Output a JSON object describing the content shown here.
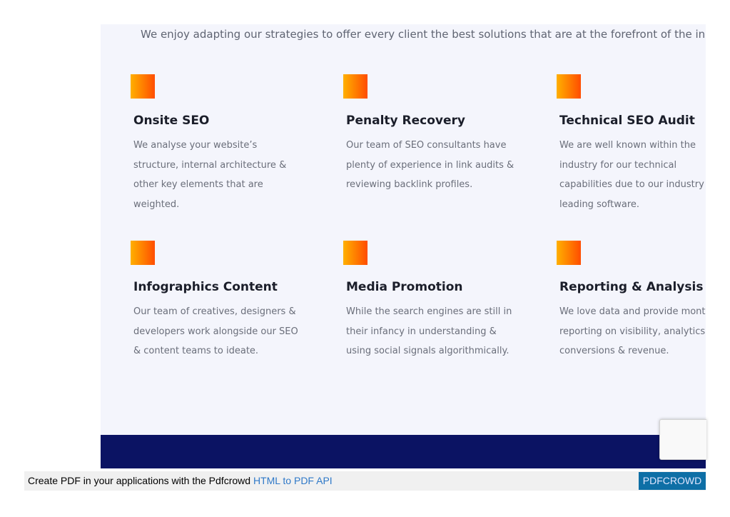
{
  "intro": {
    "text": "We enjoy adapting our strategies to offer every client the best solutions that are at the forefront of the indust"
  },
  "services": [
    {
      "title": "Onsite SEO",
      "lines": [
        "We analyse your website’s",
        "structure, internal architecture &",
        "other key elements that are",
        "weighted."
      ]
    },
    {
      "title": "Penalty Recovery",
      "lines": [
        "Our team of SEO consultants have",
        "plenty of experience in link audits &",
        "reviewing backlink profiles."
      ]
    },
    {
      "title": "Technical SEO Audit",
      "lines": [
        "We are well known within the",
        "industry for our technical",
        "capabilities due to our industry",
        "leading software."
      ]
    },
    {
      "title": "Infographics Content",
      "lines": [
        "Our team of creatives, designers &",
        "developers work alongside our SEO",
        "& content teams to ideate."
      ]
    },
    {
      "title": "Media Promotion",
      "lines": [
        "While the search engines are still in",
        "their infancy in understanding &",
        "using social signals algorithmically."
      ]
    },
    {
      "title": "Reporting & Analysis",
      "lines": [
        "We love data and provide mont",
        "reporting on visibility, analytics,",
        "conversions & revenue."
      ]
    }
  ],
  "pdf_bar": {
    "prefix": "Create PDF in your applications with the Pdfcrowd ",
    "link": "HTML to PDF API",
    "button": "PDFCROWD"
  },
  "colors": {
    "content_background": "#f4f5fc",
    "footer_band": "#0b1363",
    "icon_gradient_start": "#ffb000",
    "icon_gradient_end": "#ff4d00",
    "pdf_link": "#2f79c8",
    "pdf_button": "#0e6fa6"
  }
}
